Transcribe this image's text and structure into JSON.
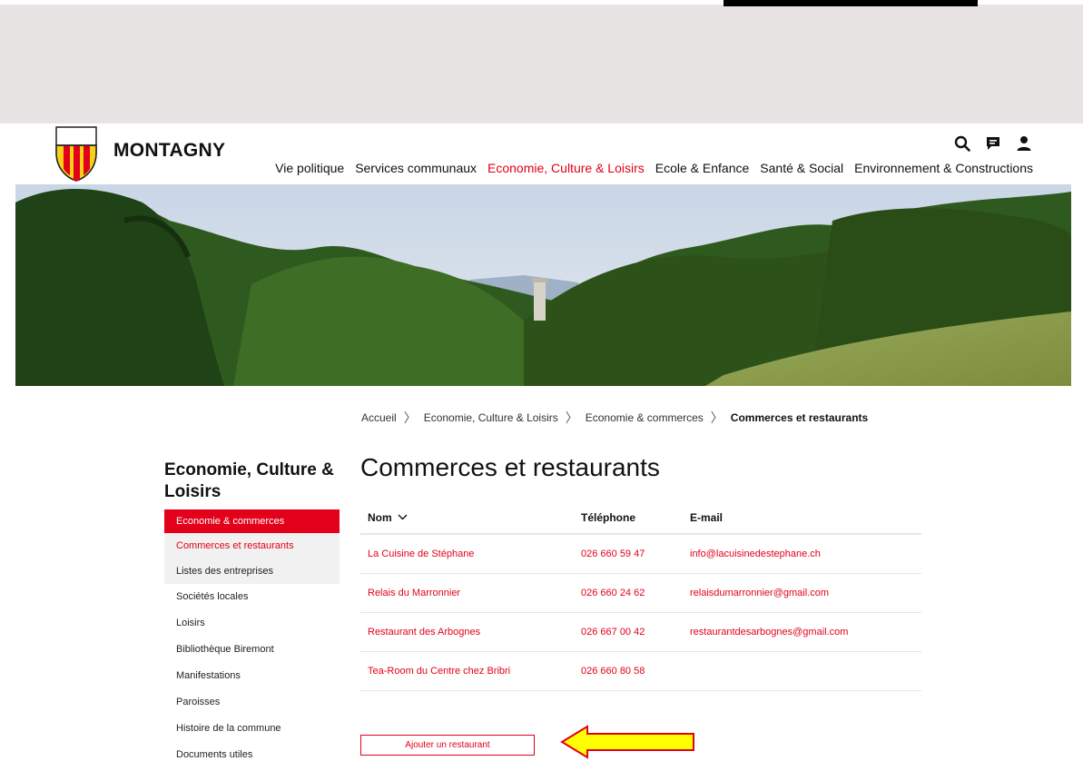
{
  "site": {
    "brand": "MONTAGNY"
  },
  "utility": {
    "icons": [
      "search-icon",
      "chat-icon",
      "user-icon"
    ]
  },
  "nav": {
    "items": [
      {
        "label": "Vie politique"
      },
      {
        "label": "Services communaux"
      },
      {
        "label": "Economie, Culture & Loisirs"
      },
      {
        "label": "Ecole & Enfance"
      },
      {
        "label": "Santé & Social"
      },
      {
        "label": "Environnement & Constructions"
      }
    ]
  },
  "breadcrumb": {
    "items": [
      "Accueil",
      "Economie, Culture & Loisirs",
      "Economie & commerces"
    ],
    "current": "Commerces et restaurants"
  },
  "sidebar": {
    "title": "Economie, Culture & Loisirs",
    "items": [
      {
        "label": "Economie & commerces"
      },
      {
        "label": "Commerces et restaurants"
      },
      {
        "label": "Listes des entreprises"
      },
      {
        "label": "Sociétés locales"
      },
      {
        "label": "Loisirs"
      },
      {
        "label": "Bibliothèque Biremont"
      },
      {
        "label": "Manifestations"
      },
      {
        "label": "Paroisses"
      },
      {
        "label": "Histoire de la commune"
      },
      {
        "label": "Documents utiles"
      }
    ]
  },
  "main": {
    "title": "Commerces et restaurants",
    "table": {
      "headers": {
        "name": "Nom",
        "phone": "Téléphone",
        "email": "E-mail"
      },
      "rows": [
        {
          "name": "La Cuisine de Stéphane",
          "phone": "026 660 59 47",
          "email": "info@lacuisinedestephane.ch"
        },
        {
          "name": "Relais du Marronnier",
          "phone": "026 660 24 62",
          "email": "relaisdumarronnier@gmail.com"
        },
        {
          "name": "Restaurant des Arbognes",
          "phone": "026 667 00 42",
          "email": "restaurantdesarbognes@gmail.com"
        },
        {
          "name": "Tea-Room du Centre chez Bribri",
          "phone": "026 660 80 58",
          "email": ""
        }
      ]
    },
    "add_button": "Ajouter un restaurant"
  },
  "colors": {
    "accent": "#e2001a",
    "annotation_arrow_fill": "#ffff00",
    "annotation_arrow_stroke": "#e2001a"
  }
}
